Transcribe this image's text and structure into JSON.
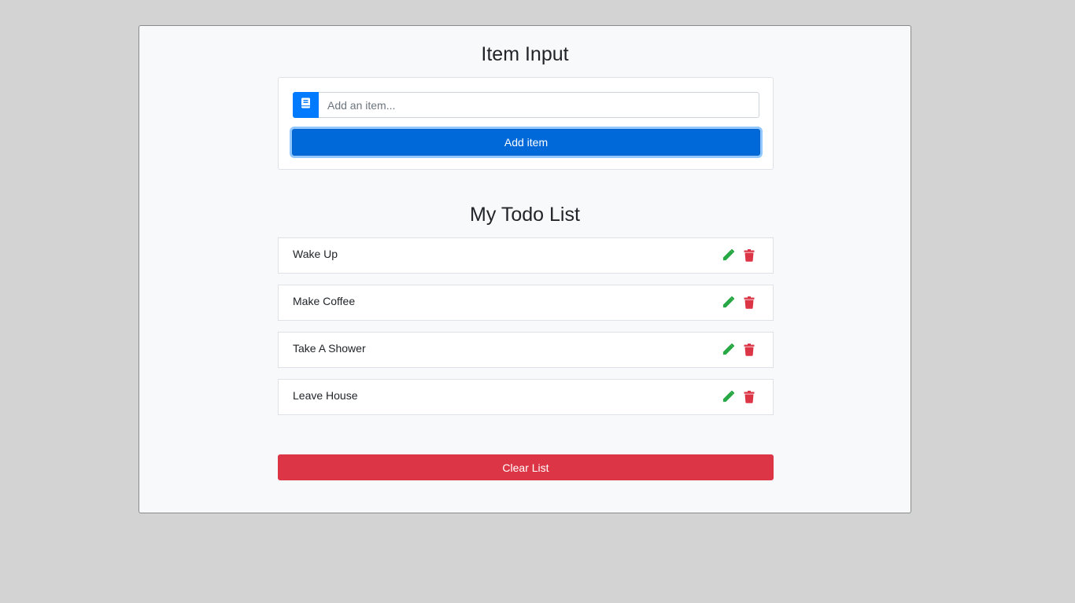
{
  "input_section": {
    "title": "Item Input",
    "icon": "book-icon",
    "input_placeholder": "Add an item...",
    "input_value": "",
    "add_button_label": "Add item"
  },
  "list_section": {
    "title": "My Todo List",
    "items": [
      {
        "text": "Wake Up"
      },
      {
        "text": "Make Coffee"
      },
      {
        "text": "Take A Shower"
      },
      {
        "text": "Leave House"
      }
    ],
    "edit_icon": "pencil-icon",
    "delete_icon": "trash-icon",
    "clear_button_label": "Clear List"
  },
  "colors": {
    "primary": "#007bff",
    "add_button": "#0069d9",
    "danger": "#dc3545",
    "edit_icon": "#28a745",
    "delete_icon": "#dc3545",
    "background": "#d3d3d3",
    "card": "#f8f9fa"
  }
}
